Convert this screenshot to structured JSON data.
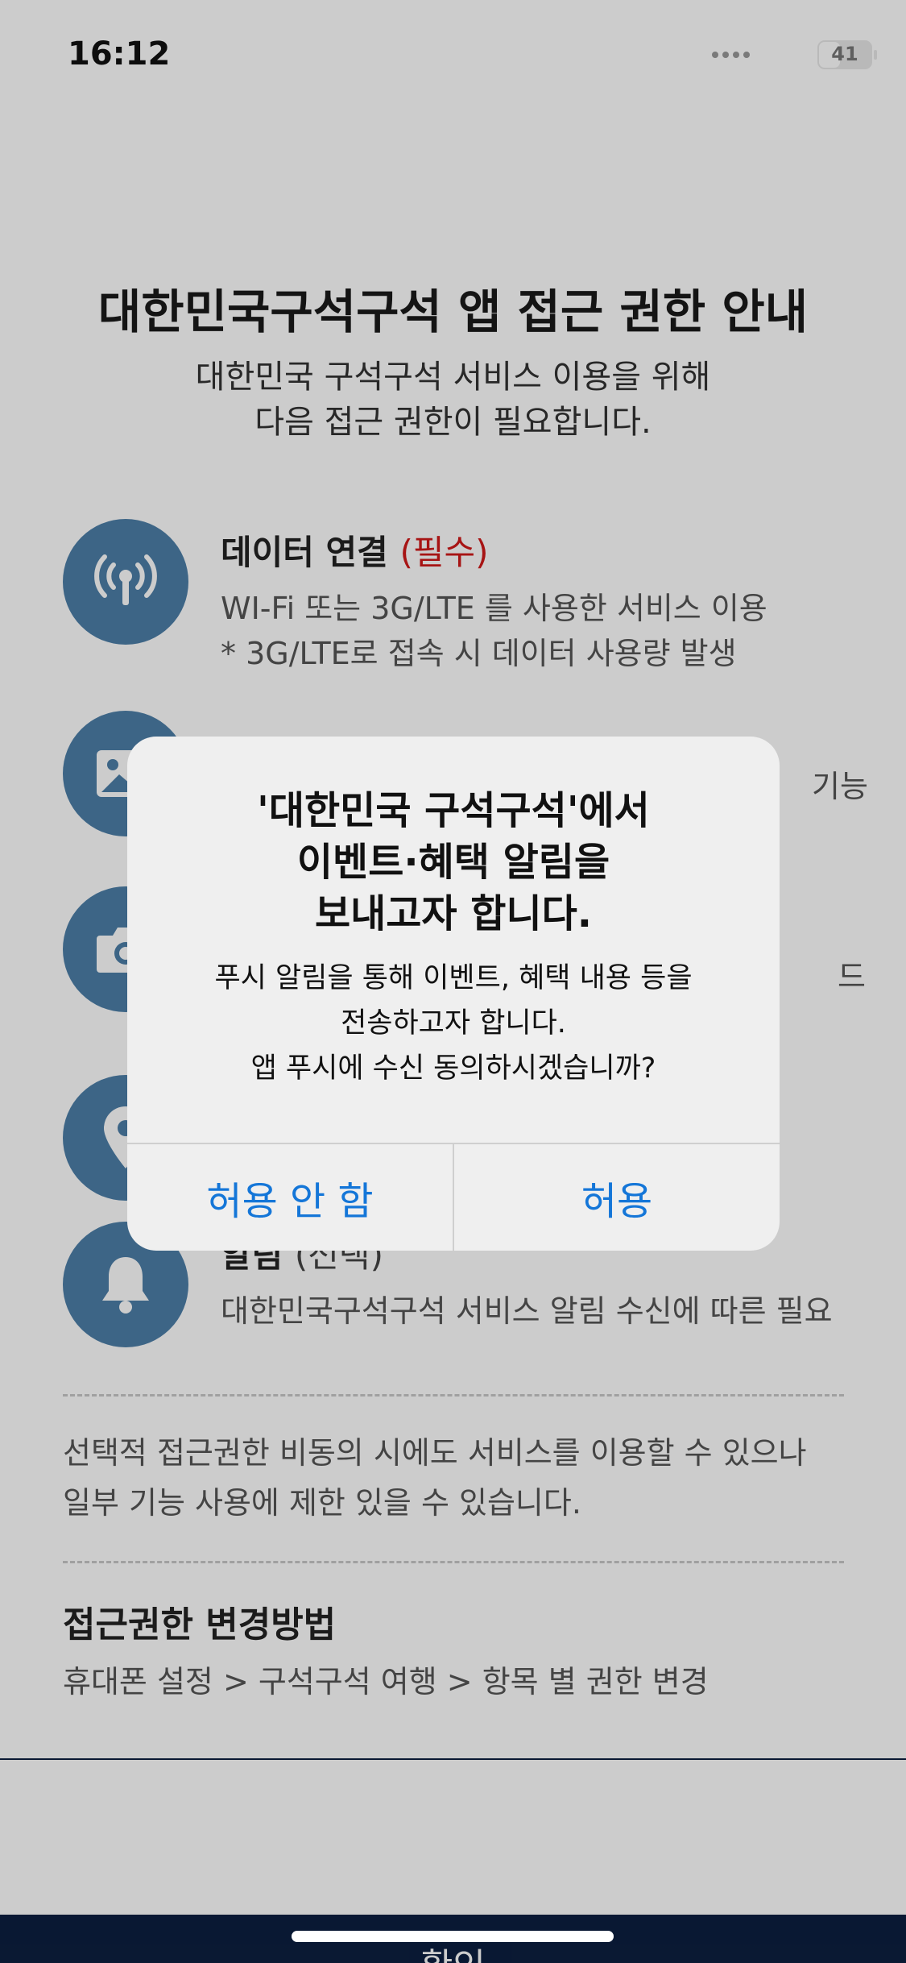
{
  "status_bar": {
    "time": "16:12",
    "battery": "41",
    "battery_fraction": 0.41
  },
  "header": {
    "title": "대한민국구석구석 앱 접근 권한 안내",
    "subtitle_lines": [
      "대한민국 구석구석 서비스 이용을 위해",
      "다음 접근 권한이 필요합니다."
    ]
  },
  "permissions": [
    {
      "title": "데이터 연결",
      "tag": "(필수)",
      "icon": "antenna-icon",
      "desc_lines": [
        "WI-Fi 또는 3G/LTE 를 사용한 서비스 이용",
        "* 3G/LTE로 접속 시 데이터 사용량 발생"
      ]
    },
    {
      "title": "",
      "tag": "",
      "icon": "image-icon",
      "desc_lines": [
        "기능"
      ]
    },
    {
      "title": "",
      "tag": "",
      "icon": "camera-icon",
      "desc_lines": [
        "드"
      ]
    },
    {
      "title": "",
      "tag": "",
      "icon": "location-pin-icon",
      "desc_lines": []
    },
    {
      "title": "알림",
      "tag": "(선택)",
      "icon": "bell-icon",
      "desc_lines": [
        "대한민국구석구석 서비스 알림 수신에 따른 필요"
      ]
    }
  ],
  "notice_lines": [
    "선택적 접근권한 비동의 시에도 서비스를 이용할 수 있으나",
    "일부 기능 사용에 제한 있을 수 있습니다."
  ],
  "howto": {
    "title": "접근권한 변경방법",
    "desc": "휴대폰 설정 > 구석구석 여행 > 항목 별 권한 변경"
  },
  "confirm_button": "확인",
  "alert": {
    "title_lines": [
      "'대한민국 구석구석'에서",
      "이벤트·혜택 알림을",
      "보내고자 합니다."
    ],
    "message_lines": [
      "푸시 알림을 통해 이벤트, 혜택 내용 등을",
      "전송하고자 합니다.",
      "앱 푸시에 수신 동의하시겠습니까?"
    ],
    "deny_button": "허용 안 함",
    "allow_button": "허용"
  },
  "colors": {
    "icon_bg": "#4d7fa8",
    "required": "#d11a1a",
    "alert_button": "#1476d8",
    "bottom_bar": "#0c1f40"
  }
}
